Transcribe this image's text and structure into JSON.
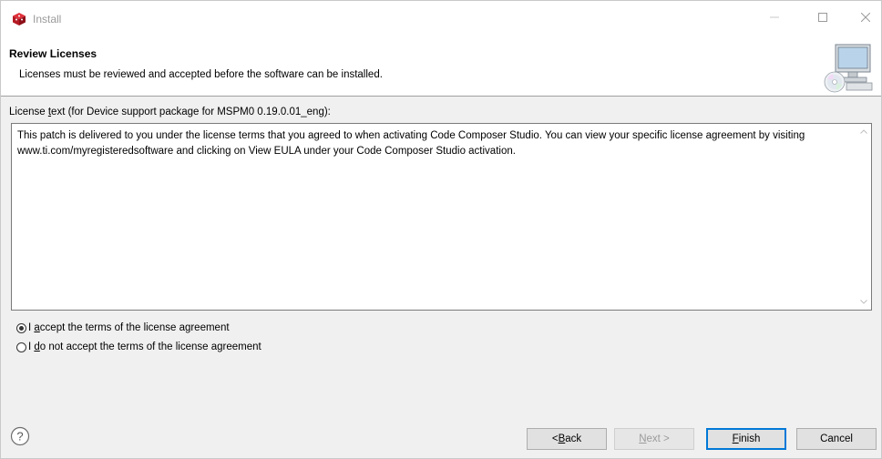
{
  "window": {
    "title": "Install"
  },
  "header": {
    "title": "Review Licenses",
    "description": "Licenses must be reviewed and accepted before the software can be installed."
  },
  "license": {
    "label_prefix": "License ",
    "label_mnemonic": "t",
    "label_rest": "ext (for Device support package for MSPM0 0.19.0.01_eng):",
    "text": "This patch is delivered to you under the license terms that you agreed to when activating Code Composer Studio.  You can view your specific license agreement by visiting www.ti.com/myregisteredsoftware and clicking on View EULA under your Code Composer Studio activation."
  },
  "options": {
    "accept": {
      "prefix": "I ",
      "mnemonic": "a",
      "rest": "ccept the terms of the license agreement",
      "selected": true
    },
    "decline": {
      "prefix": "I ",
      "mnemonic": "d",
      "rest": "o not accept the terms of the license agreement",
      "selected": false
    }
  },
  "buttons": {
    "back_prefix": "< ",
    "back_mnemonic": "B",
    "back_rest": "ack",
    "next_mnemonic": "N",
    "next_rest": "ext >",
    "finish_mnemonic": "F",
    "finish_rest": "inish",
    "cancel": "Cancel"
  },
  "colors": {
    "accent": "#0078d7",
    "icon_red": "#c8102e"
  }
}
